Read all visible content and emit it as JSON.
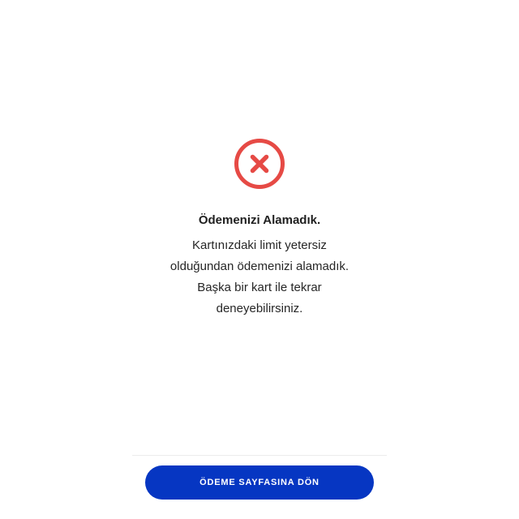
{
  "status": {
    "icon": "error-x-circle-icon",
    "icon_color": "#e64a45",
    "title": "Ödemenizi Alamadık.",
    "message_lines": [
      "Kartınızdaki limit yetersiz",
      "olduğundan ödemenizi alamadık.",
      "Başka bir kart ile tekrar",
      "deneyebilirsiniz."
    ]
  },
  "actions": {
    "primary_label": "ÖDEME SAYFASINA DÖN",
    "primary_color": "#0636c2"
  }
}
